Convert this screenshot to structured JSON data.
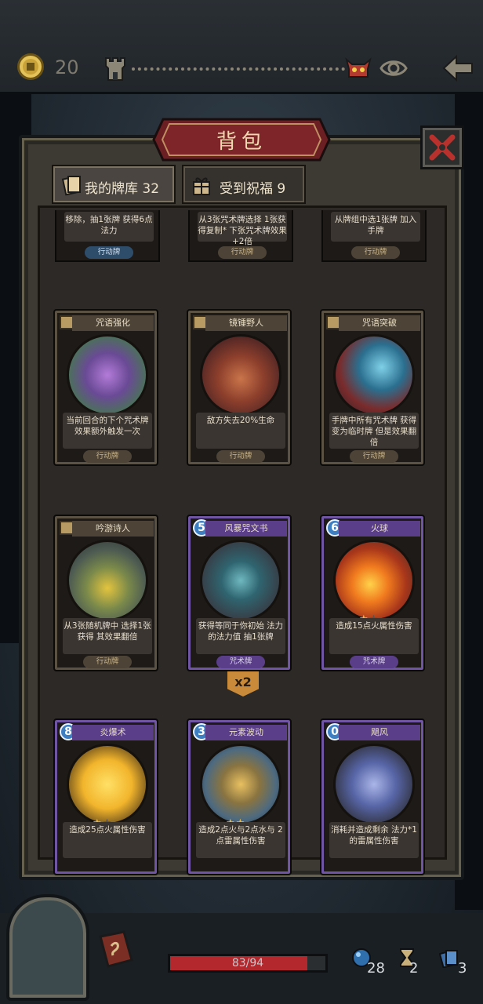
{
  "topbar": {
    "coins": "20"
  },
  "modal": {
    "title": "背包",
    "tabs": [
      {
        "label": "我的牌库 32"
      },
      {
        "label": "受到祝福 9"
      }
    ]
  },
  "cards_partial": [
    {
      "desc": "移除，抽1张牌 获得6点法力",
      "type": "行动牌"
    },
    {
      "desc": "从3张咒术牌选择 1张获得复制* 下张咒术牌效果+2倍",
      "type": "行动牌"
    },
    {
      "desc": "从牌组中选1张牌 加入手牌",
      "type": "行动牌"
    }
  ],
  "cards": [
    {
      "name": "咒语强化",
      "cost": "",
      "desc": "当前回合的下个咒术牌 效果额外触发一次",
      "type": "行动牌",
      "kind": "action",
      "stars": 0
    },
    {
      "name": "镜锤野人",
      "cost": "",
      "desc": "敌方失去20%生命",
      "type": "行动牌",
      "kind": "action",
      "stars": 0
    },
    {
      "name": "咒语突破",
      "cost": "",
      "desc": "手牌中所有咒术牌 获得变为临时牌 但是效果翻倍",
      "type": "行动牌",
      "kind": "action",
      "stars": 0
    },
    {
      "name": "吟游诗人",
      "cost": "",
      "desc": "从3张随机牌中 选择1张获得 其效果翻倍",
      "type": "行动牌",
      "kind": "action",
      "stars": 0
    },
    {
      "name": "风暴咒文书",
      "cost": "5",
      "desc": "获得等同于你初始 法力的法力值 抽1张牌",
      "type": "咒术牌",
      "kind": "spell",
      "stars": 0
    },
    {
      "name": "火球",
      "cost": "6",
      "desc": "造成15点火属性伤害",
      "type": "咒术牌",
      "kind": "spell",
      "stars": 1
    },
    {
      "name": "炎爆术",
      "cost": "8",
      "desc": "造成25点火属性伤害",
      "type": "咒术牌",
      "kind": "spell",
      "stars": 1
    },
    {
      "name": "元素波动",
      "cost": "3",
      "desc": "造成2点火与2点水与 2点雷属性伤害",
      "type": "咒术牌",
      "kind": "spell",
      "stars": 2
    },
    {
      "name": "飓风",
      "cost": "0",
      "desc": "消耗并造成剩余 法力*1的雷属性伤害",
      "type": "咒术牌",
      "kind": "spell",
      "stars": 0
    }
  ],
  "x2_badge": "x2",
  "bottom": {
    "hp_text": "83/94",
    "hp_fraction": 0.883,
    "mana": "28",
    "hourglass": "2",
    "cards": "3"
  },
  "colors": {
    "spell": "#5b3e8a",
    "action": "#4d4437",
    "hp": "#b3282d",
    "cost": "#3e7fc2"
  }
}
